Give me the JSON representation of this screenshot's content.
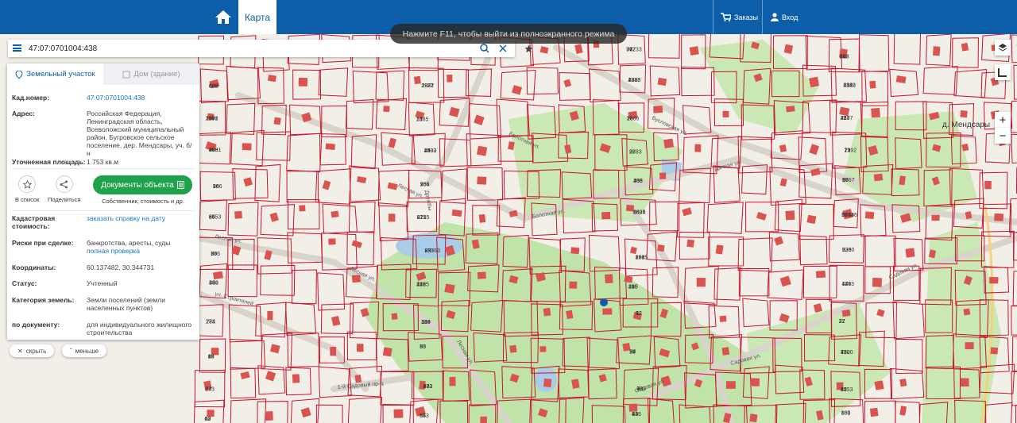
{
  "topbar": {
    "tab_map": "Карта",
    "orders": "Заказы",
    "login": "Вход"
  },
  "toast": "Нажмите F11, чтобы выйти из полноэкранного режима",
  "search": {
    "value": "47:07:0701004:438"
  },
  "panel": {
    "tabs": [
      "Земельный участок",
      "Дом (здание)"
    ],
    "cad_label": "Кад.номер:",
    "cad_value": "47:07:0701004:438",
    "addr_label": "Адрес:",
    "addr_value": "Российская Федерация, Ленинградская область, Всеволожский муниципальный район, Бугровское сельское поселение, дер. Мендсары, уч. б/н",
    "area_label": "Уточненная площадь:",
    "area_value": "1 753 кв.м",
    "act_list": "В список",
    "act_share": "Поделиться",
    "doc_button": "Документы объекта",
    "doc_sub": "Собственник, стоимость и др.",
    "cost_label": "Кадастровая стоимость:",
    "cost_value": "заказать справку на дату",
    "risk_label": "Риски при сделке:",
    "risk_value": "банкротства, аресты, суды",
    "risk_link": "полная проверка",
    "coord_label": "Координаты:",
    "coord_value": "60.137482, 30.344731",
    "status_label": "Статус:",
    "status_value": "Учтенный",
    "cat_label": "Категория земель:",
    "cat_value": "Земли поселений (земли населенных пунктов)",
    "doc_label": "по документу:",
    "doc_value": "для индивидуального жилищного строительства"
  },
  "controls": {
    "hide": "скрыть",
    "less": "меньше",
    "zoom_in": "+",
    "zoom_out": "−"
  },
  "map": {
    "village": "д. Мендсары",
    "streets": [
      "Болотная ул.",
      "Болотная ул.",
      "Дачная ул.",
      "Лесная ул.",
      "Лесная ул.",
      "ул. Строителей",
      "Лесная ул.",
      "Садовая ул.",
      "Садовая ул.",
      "Садовая ул.",
      "Бусловская ул.",
      "Лесная ул.",
      "Дружбы",
      "1-й Садовый пр-д"
    ],
    "parcels": [
      "668",
      "680",
      "742",
      "17",
      "413",
      "1321",
      "1323",
      "1322",
      "1371",
      "14",
      "18",
      "27",
      "90",
      "1403",
      "2",
      "13",
      "10",
      "95",
      "436",
      "56",
      "66",
      "871",
      "2694",
      "2693",
      "866",
      "837",
      "858",
      "2360",
      "851",
      "1285",
      "20",
      "1443",
      "283",
      "289",
      "12",
      "22",
      "99",
      "55",
      "54",
      "72",
      "74",
      "30",
      "3",
      "61",
      "62",
      "65",
      "63",
      "860",
      "1442",
      "834",
      "97733",
      "288",
      "892",
      "2877",
      "428",
      "414",
      "110",
      "1",
      "73",
      "417",
      "408",
      "45",
      "97",
      "79",
      "98",
      "106",
      "108",
      "86",
      "85",
      "91",
      "88",
      "57",
      "50",
      "97563",
      "290",
      "5",
      "44",
      "416",
      "415",
      "429",
      "274",
      "104",
      "22",
      "37",
      "43",
      "6",
      "29",
      "430",
      "273",
      "432",
      "433",
      "35",
      "40",
      "34",
      "24",
      "101",
      "917",
      "12",
      "76",
      "405",
      "406",
      "2882",
      "2888",
      "2889",
      "2890",
      "2885",
      "2886",
      "2887",
      "2891",
      "2892",
      "2883",
      "2192",
      "266",
      "264",
      "265",
      "1767",
      "2453",
      "2295",
      "1825",
      "98446",
      "27",
      "25",
      "1615",
      "329",
      "330",
      "242",
      "240",
      "47",
      "77",
      "31",
      "9",
      "27",
      "16",
      "33",
      "97",
      "1520",
      "8",
      "873",
      "76",
      "1253",
      "67",
      "843",
      "436"
    ]
  },
  "colors": {
    "brand": "#0d5ea8",
    "green_button": "#1ea34a",
    "parcel_line": "#c8142c",
    "house": "#d9534f",
    "park": "#bfe3a8"
  }
}
